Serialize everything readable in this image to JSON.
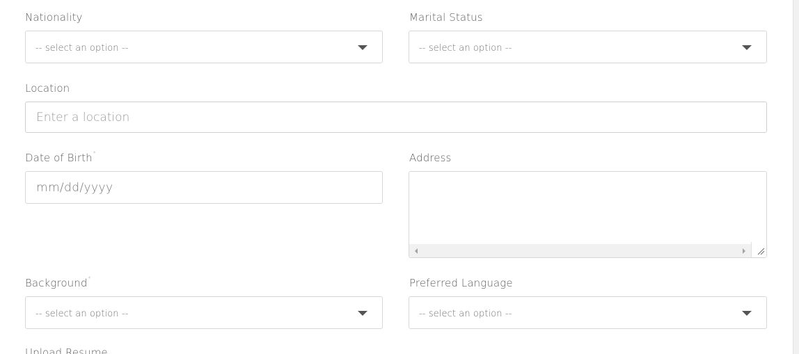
{
  "form": {
    "nationality": {
      "label": "Nationality",
      "value": "-- select an option --"
    },
    "marital_status": {
      "label": "Marital Status",
      "value": "-- select an option --"
    },
    "location": {
      "label": "Location",
      "placeholder": "Enter a location"
    },
    "date_of_birth": {
      "label": "Date of Birth",
      "required_mark": "*",
      "placeholder": "mm/dd/yyyy"
    },
    "address": {
      "label": "Address",
      "value": ""
    },
    "background": {
      "label": "Background",
      "required_mark": "*",
      "value": "-- select an option --"
    },
    "preferred_language": {
      "label": "Preferred Language",
      "value": "-- select an option --"
    },
    "upload_resume": {
      "label": "Upload Resume"
    }
  },
  "icons": {
    "dropdown": "caret-down-icon",
    "scroll_left": "scroll-left-arrow-icon",
    "scroll_right": "scroll-right-arrow-icon",
    "resize": "resize-grip-icon"
  },
  "colors": {
    "label": "#5e5e5e",
    "border": "#d8d8d8",
    "placeholder": "#9a9a9a",
    "caret": "#555555"
  }
}
